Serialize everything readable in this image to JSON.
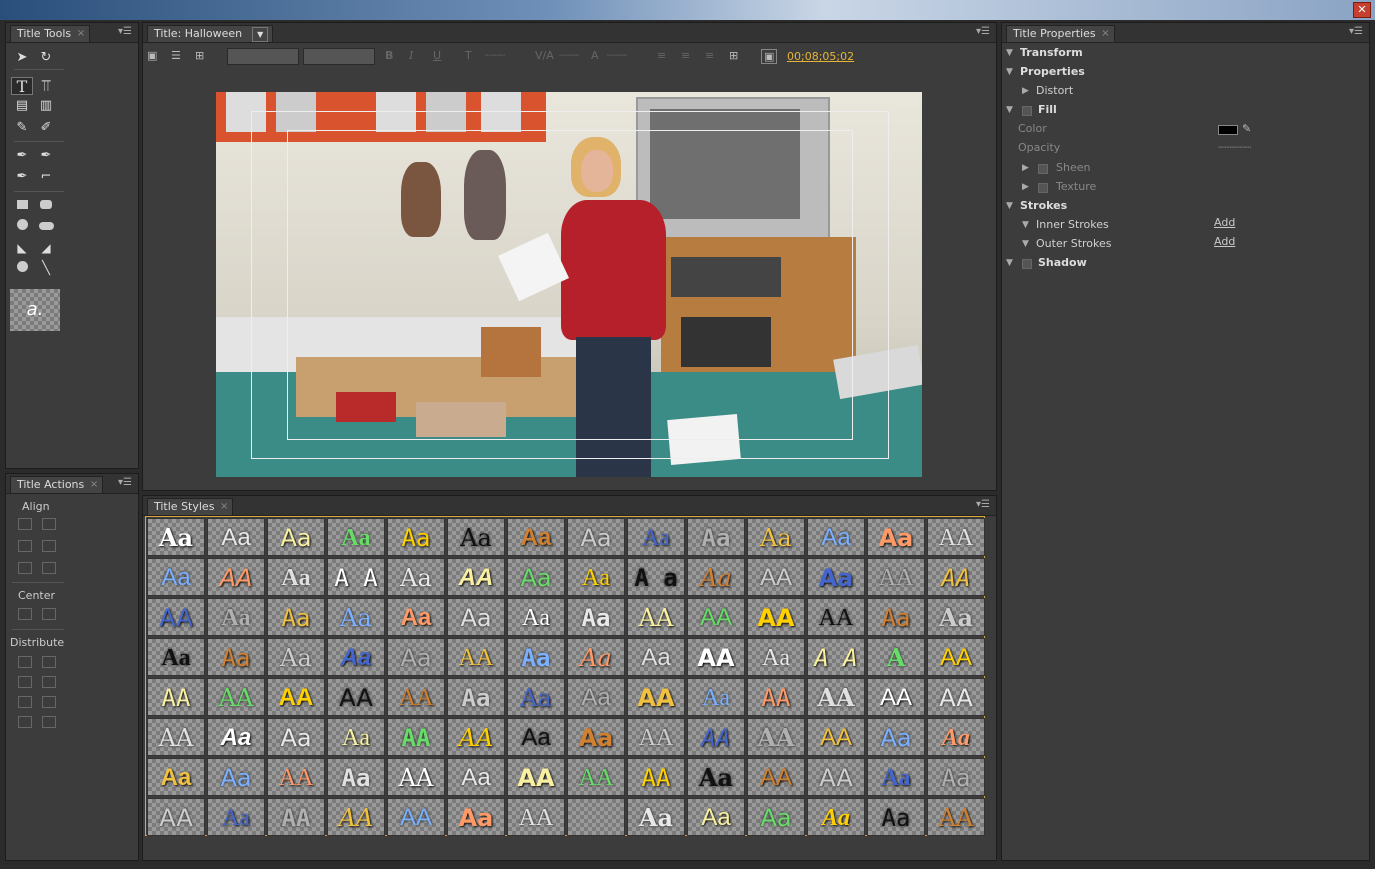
{
  "window": {
    "close_glyph": "✕"
  },
  "title_tools": {
    "tab": "Title Tools",
    "icons": [
      "selection-icon",
      "rotation-icon",
      "type-icon",
      "vertical-type-icon",
      "area-type-icon",
      "vertical-area-type-icon",
      "path-type-icon",
      "vertical-path-type-icon",
      "pen-icon",
      "add-anchor-icon",
      "delete-anchor-icon",
      "convert-anchor-icon",
      "rectangle-icon",
      "rounded-rectangle-icon",
      "clipped-corner-rectangle-icon",
      "rounded-corner-icon",
      "ellipse-icon",
      "capsule-icon",
      "wedge-icon",
      "arc-icon",
      "circle-icon",
      "line-icon"
    ],
    "preview_glyph": "a."
  },
  "title_actions": {
    "tab": "Title Actions",
    "align": "Align",
    "center": "Center",
    "distribute": "Distribute"
  },
  "editor": {
    "tab": "Title: Halloween",
    "timecode": "00;08;05;02",
    "bold": "B",
    "italic": "I",
    "underline": "U"
  },
  "title_styles": {
    "tab": "Title Styles",
    "swatches": [
      [
        "Aa",
        "Aa",
        "Aa",
        "Aa",
        "Aa",
        "Aa",
        "Aa",
        "Aa",
        "Aa",
        "Aa",
        "Aa",
        "Aa",
        "Aa",
        "AA"
      ],
      [
        "Aa",
        "AA",
        "Aa",
        "A A",
        "Aa",
        "AA",
        "Aa",
        "Aa",
        "A a",
        "Aa",
        "AA",
        "Aa",
        "AA",
        "AA"
      ],
      [
        "AA",
        "Aa",
        "Aa",
        "Aa",
        "Aa",
        "Aa",
        "Aa",
        "Aa",
        "AA",
        "AA",
        "AA",
        "AA",
        "Aa",
        "Aa"
      ],
      [
        "Aa",
        "Aa",
        "Aa",
        "Aa",
        "Aa",
        "AA",
        "Aa",
        "Aa",
        "Aa",
        "AA",
        "Aa",
        "A A",
        "A",
        "AA"
      ],
      [
        "AA",
        "AA",
        "AA",
        "AA",
        "AA",
        "Aa",
        "Aa",
        "Aa",
        "AA",
        "Aa",
        "AA",
        "AA",
        "AA",
        "AA"
      ],
      [
        "AA",
        "Aa",
        "Aa",
        "Aa",
        "AA",
        "AA",
        "Aa",
        "Aa",
        "AA",
        "AA",
        "AA",
        "AA",
        "Aa",
        "Aa"
      ],
      [
        "Aa",
        "Aa",
        "AA",
        "Aa",
        "AA",
        "Aa",
        "AA",
        "AA",
        "AA",
        "Aa",
        "AA",
        "AA",
        "Aa",
        "Aa"
      ],
      [
        "AA",
        "Aa",
        "AA",
        "AA",
        "AA",
        "Aa",
        "AA",
        "",
        "Aa",
        "Aa",
        "Aa",
        "Aa",
        "Aa",
        "AA"
      ]
    ]
  },
  "title_properties": {
    "tab": "Title Properties",
    "transform": "Transform",
    "properties": "Properties",
    "distort": "Distort",
    "fill": "Fill",
    "color": "Color",
    "opacity": "Opacity",
    "sheen": "Sheen",
    "texture": "Texture",
    "strokes": "Strokes",
    "inner_strokes": "Inner Strokes",
    "outer_strokes": "Outer Strokes",
    "add": "Add",
    "shadow": "Shadow",
    "fill_color": "#000000"
  }
}
